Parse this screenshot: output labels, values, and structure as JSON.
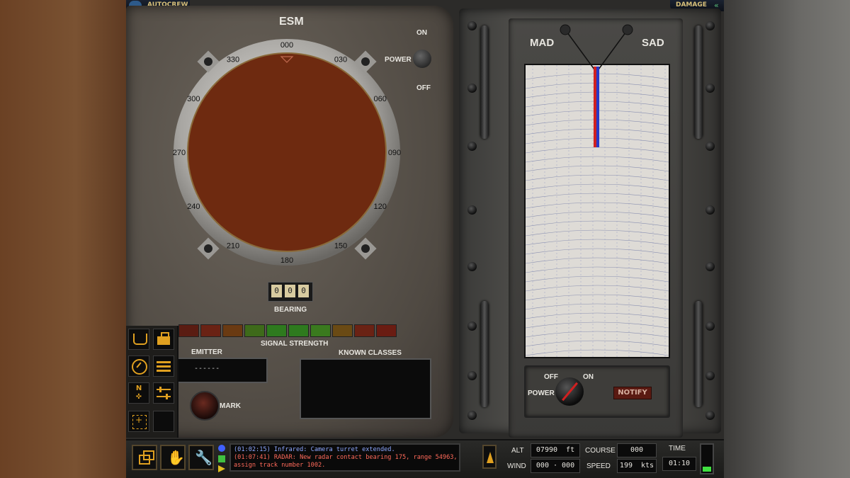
{
  "top_bar": {
    "autocrew_label": "AUTOCREW",
    "damage_label": "DAMAGE"
  },
  "esm": {
    "title": "ESM",
    "power_label": "POWER",
    "on_label": "ON",
    "off_label": "OFF",
    "compass_ticks": [
      "000",
      "030",
      "060",
      "090",
      "120",
      "150",
      "180",
      "210",
      "240",
      "270",
      "300",
      "330"
    ],
    "bearing_digits": [
      "0",
      "0",
      "0"
    ],
    "bearing_label": "BEARING",
    "signal_strength_label": "SIGNAL STRENGTH",
    "emitter_label": "EMITTER",
    "emitter_value": "------",
    "known_classes_label": "KNOWN CLASSES",
    "mark_label": "MARK",
    "signal_colors": [
      "#5a1c12",
      "#6a2214",
      "#6a3a12",
      "#3e6a1a",
      "#2e7a1e",
      "#2e7a1e",
      "#3a7a1e",
      "#6a4a14",
      "#6a2214",
      "#6a1c12"
    ]
  },
  "mad": {
    "mad_label": "MAD",
    "sad_label": "SAD",
    "power_label": "POWER",
    "off_label": "OFF",
    "on_label": "ON",
    "notify_label": "NOTIFY"
  },
  "messages": [
    {
      "text": "(01:02:15) Infrared: Camera turret extended.",
      "color": "#8ea8ff"
    },
    {
      "text": "(01:07:41) RADAR: New radar contact bearing 175, range 54963,",
      "color": "#ff6a5a"
    },
    {
      "text": "assign track number 1002.",
      "color": "#ff6a5a"
    }
  ],
  "status": {
    "alt_label": "ALT",
    "alt_value": "07990",
    "alt_unit": "ft",
    "wind_label": "WIND",
    "wind_value": "000 · 000",
    "course_label": "COURSE",
    "course_value": "000",
    "speed_label": "SPEED",
    "speed_value": "199",
    "speed_unit": "kts",
    "time_label": "TIME",
    "time_value": "01:10"
  },
  "sidebar_icons": [
    "crew-station-icon",
    "toolbox-icon",
    "gauge-icon",
    "sonar-waves-icon",
    "compass-rose-icon",
    "sliders-icon",
    "target-reticle-icon",
    "empty-slot"
  ],
  "bottom_icons": [
    "windows-icon",
    "hand-icon",
    "wrench-icon"
  ]
}
